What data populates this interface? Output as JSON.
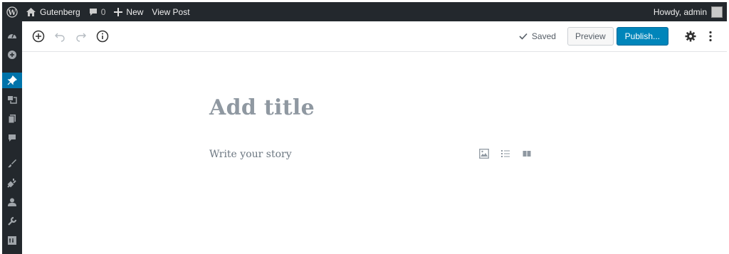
{
  "admin_bar": {
    "site_name": "Gutenberg",
    "comments_count": "0",
    "new_label": "New",
    "view_post_label": "View Post",
    "howdy": "Howdy, admin"
  },
  "sidebar": {
    "items": [
      {
        "icon": "dashboard-icon"
      },
      {
        "icon": "gutenberg-icon"
      },
      {
        "icon": "posts-icon",
        "active": true
      },
      {
        "icon": "media-icon"
      },
      {
        "icon": "pages-icon"
      },
      {
        "icon": "comments-icon"
      },
      {
        "icon": "appearance-icon"
      },
      {
        "icon": "plugins-icon"
      },
      {
        "icon": "users-icon"
      },
      {
        "icon": "tools-icon"
      },
      {
        "icon": "settings-icon"
      }
    ]
  },
  "toolbar": {
    "saved_label": "Saved",
    "preview_label": "Preview",
    "publish_label": "Publish..."
  },
  "content": {
    "title_placeholder": "Add title",
    "paragraph_placeholder": "Write your story"
  },
  "colors": {
    "admin_bar_bg": "#23282d",
    "accent": "#0073aa",
    "publish_button": "#0085ba"
  }
}
